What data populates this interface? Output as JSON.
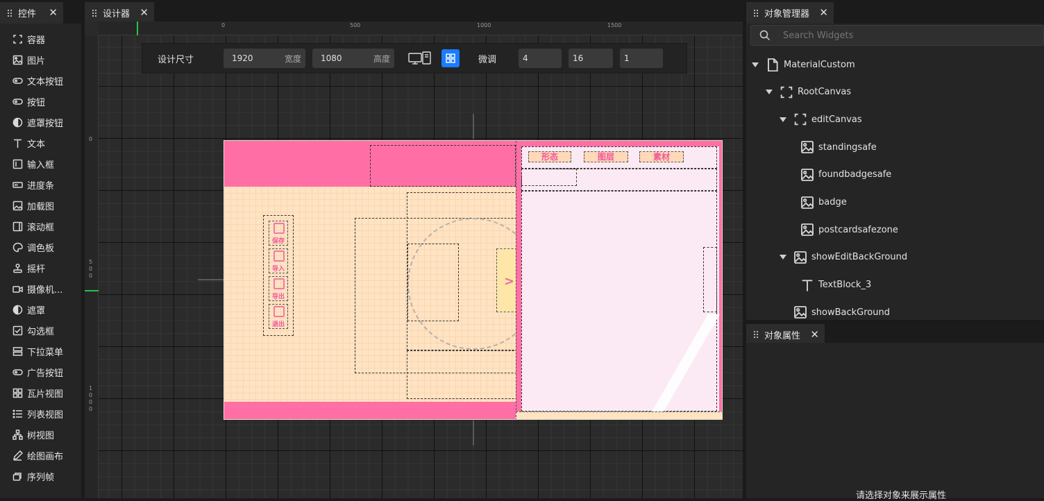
{
  "left_panel": {
    "title": "控件",
    "widgets": [
      {
        "label": "容器",
        "icon": "container-icon"
      },
      {
        "label": "图片",
        "icon": "image-icon"
      },
      {
        "label": "文本按钮",
        "icon": "text-button-icon"
      },
      {
        "label": "按钮",
        "icon": "button-icon"
      },
      {
        "label": "遮罩按钮",
        "icon": "mask-button-icon"
      },
      {
        "label": "文本",
        "icon": "text-icon"
      },
      {
        "label": "输入框",
        "icon": "input-icon"
      },
      {
        "label": "进度条",
        "icon": "progress-icon"
      },
      {
        "label": "加载图",
        "icon": "loading-image-icon"
      },
      {
        "label": "滚动框",
        "icon": "scroll-icon"
      },
      {
        "label": "调色板",
        "icon": "palette-icon"
      },
      {
        "label": "摇杆",
        "icon": "joystick-icon"
      },
      {
        "label": "摄像机...",
        "icon": "camera-icon"
      },
      {
        "label": "遮罩",
        "icon": "mask-icon"
      },
      {
        "label": "勾选框",
        "icon": "checkbox-icon"
      },
      {
        "label": "下拉菜单",
        "icon": "dropdown-icon"
      },
      {
        "label": "广告按钮",
        "icon": "ad-button-icon"
      },
      {
        "label": "瓦片视图",
        "icon": "tile-view-icon"
      },
      {
        "label": "列表视图",
        "icon": "list-view-icon"
      },
      {
        "label": "树视图",
        "icon": "tree-view-icon"
      },
      {
        "label": "绘图画布",
        "icon": "draw-canvas-icon"
      },
      {
        "label": "序列帧",
        "icon": "sequence-frame-icon"
      }
    ]
  },
  "designer": {
    "title": "设计器",
    "toolbar": {
      "size_label": "设计尺寸",
      "width_value": "1920",
      "width_unit": "宽度",
      "height_value": "1080",
      "height_unit": "高度",
      "fine_tune_label": "微调",
      "fine_values": [
        "4",
        "16",
        "1"
      ]
    },
    "ruler_top": [
      "0",
      "500",
      "1000",
      "1500"
    ],
    "ruler_left": [
      "0",
      "5\n0\n0",
      "1\n0\n0\n0"
    ],
    "canvas": {
      "tabs": [
        "形态",
        "图层",
        "素材"
      ],
      "side_buttons": [
        "保存",
        "导入",
        "导出",
        "退出"
      ]
    }
  },
  "object_manager": {
    "title": "对象管理器",
    "search_placeholder": "Search Widgets",
    "tree": [
      {
        "label": "MaterialCustom",
        "icon": "file-icon",
        "level": 0,
        "expanded": true
      },
      {
        "label": "RootCanvas",
        "icon": "container-icon",
        "level": 1,
        "expanded": true
      },
      {
        "label": "editCanvas",
        "icon": "container-icon",
        "level": 2,
        "expanded": true
      },
      {
        "label": "standingsafe",
        "icon": "image-icon",
        "level": 3,
        "expanded": false
      },
      {
        "label": "foundbadgesafe",
        "icon": "image-icon",
        "level": 3,
        "expanded": false
      },
      {
        "label": "badge",
        "icon": "image-icon",
        "level": 3,
        "expanded": false
      },
      {
        "label": "postcardsafezone",
        "icon": "image-icon",
        "level": 3,
        "expanded": false
      },
      {
        "label": "showEditBackGround",
        "icon": "image-icon",
        "level": 2,
        "expanded": true
      },
      {
        "label": "TextBlock_3",
        "icon": "text-icon",
        "level": 3,
        "expanded": false
      },
      {
        "label": "showBackGround",
        "icon": "image-icon",
        "level": 2,
        "expanded": false
      }
    ]
  },
  "properties": {
    "title": "对象属性",
    "empty_hint": "请选择对象来展示属性"
  },
  "colors": {
    "accent": "#1a7cff",
    "canvas_pink": "#ff6fa6",
    "canvas_peach": "#ffe3c2",
    "canvas_light": "#fbeaf3"
  }
}
